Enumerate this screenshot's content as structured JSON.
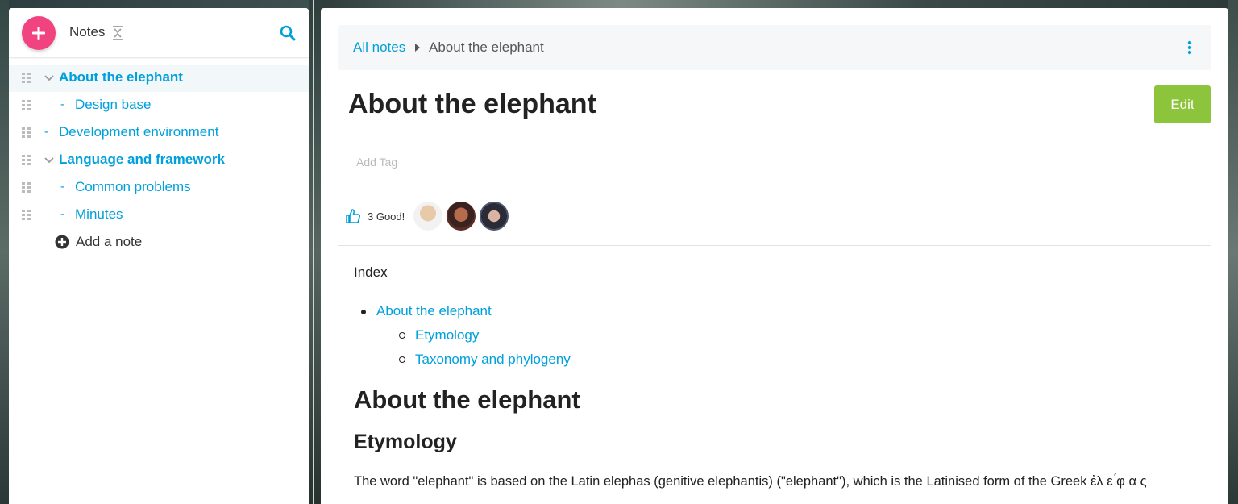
{
  "sidebar": {
    "title": "Notes",
    "new_button_icon": "plus-icon",
    "items": [
      {
        "label": "About the elephant",
        "level": 0,
        "expanded": true,
        "bold": true,
        "active": true
      },
      {
        "label": "Design base",
        "level": 1,
        "bold": false
      },
      {
        "label": "Development environment",
        "level": 0,
        "bold": false
      },
      {
        "label": "Language and framework",
        "level": 0,
        "expanded": true,
        "bold": true
      },
      {
        "label": "Common problems",
        "level": 1,
        "bold": false
      },
      {
        "label": "Minutes",
        "level": 1,
        "bold": false
      }
    ],
    "dash": "-",
    "add_note_label": "Add a note"
  },
  "breadcrumb": {
    "root": "All notes",
    "current": "About the elephant"
  },
  "note": {
    "title": "About the elephant",
    "edit_label": "Edit",
    "add_tag_placeholder": "Add Tag",
    "like_count_label": "3 Good!",
    "index_label": "Index",
    "toc": {
      "l1": "About the elephant",
      "l2a": "Etymology",
      "l2b": "Taxonomy and phylogeny"
    },
    "heading1": "About the elephant",
    "heading2": "Etymology",
    "paragraph": "The word \"elephant\" is based on the Latin elephas (genitive elephantis) (\"elephant\"), which is the Latinised form of the Greek ἐλ ε ́φ α ς"
  },
  "colors": {
    "accent": "#00a0dc",
    "new_button": "#f0437f",
    "edit_button": "#8cc43c"
  }
}
